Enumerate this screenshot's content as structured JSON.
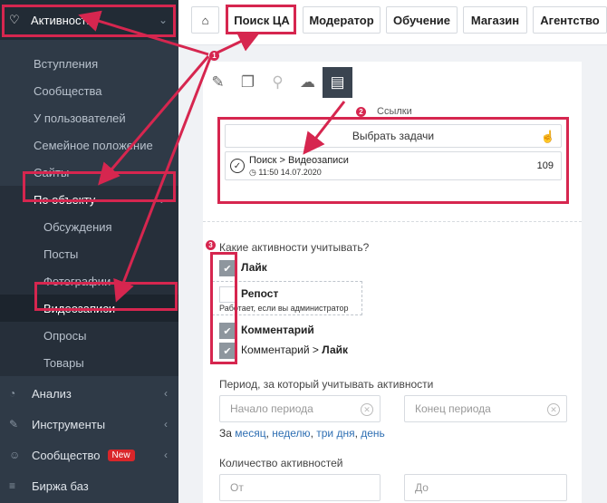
{
  "sidebar": {
    "top": {
      "label": "Активности"
    },
    "sub_items": [
      "Вступления",
      "Сообщества",
      "У пользователей",
      "Семейное положение",
      "Сайты"
    ],
    "group": {
      "label": "По объекту"
    },
    "group_items": [
      "Обсуждения",
      "Посты",
      "Фотографии",
      "Видеозаписи",
      "Опросы",
      "Товары"
    ],
    "main_items": [
      {
        "label": "Анализ",
        "icon": "clock-icon"
      },
      {
        "label": "Инструменты",
        "icon": "wrench-icon"
      },
      {
        "label": "Сообщество",
        "icon": "users-icon",
        "badge": "New"
      },
      {
        "label": "Биржа баз",
        "icon": "list-icon"
      }
    ]
  },
  "tabs": [
    "Поиск ЦА",
    "Модератор",
    "Обучение",
    "Магазин",
    "Агентство"
  ],
  "content": {
    "section_label": "Ссылки",
    "select_tasks": "Выбрать задачи",
    "task": {
      "name": "Поиск > Видеозаписи",
      "time": "11:50 14.07.2020",
      "count": "109"
    },
    "question": "Какие активности учитывать?",
    "options": [
      {
        "label": "Лайк",
        "checked": true
      },
      {
        "label": "Репост",
        "checked": false
      },
      {
        "label": "Комментарий",
        "checked": true
      },
      {
        "label_pre": "Комментарий > ",
        "label_bold": "Лайк",
        "checked": true
      }
    ],
    "repost_hint": "Работает, если вы администратор",
    "period_title": "Период, за который учитывать активности",
    "period_start_placeholder": "Начало периода",
    "period_end_placeholder": "Конец периода",
    "quick_prefix": "За",
    "quick_links": [
      "месяц",
      "неделю",
      "три дня",
      "день"
    ],
    "count_title": "Количество активностей",
    "from_placeholder": "От",
    "to_placeholder": "До"
  },
  "annotations": [
    "1",
    "2",
    "3"
  ],
  "colors": {
    "sidebar": "#2f3a47",
    "accent": "#d6264f",
    "link": "#2f6fb3"
  }
}
